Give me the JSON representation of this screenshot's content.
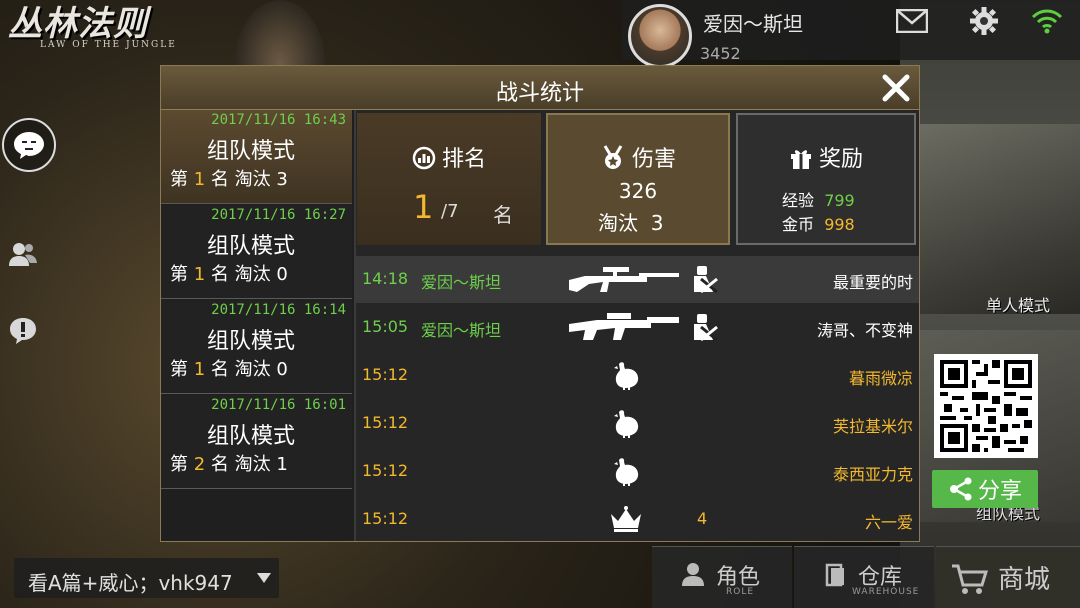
{
  "app": {
    "logo_title": "丛林法则",
    "logo_subtitle": "LAW OF THE JUNGLE"
  },
  "topbar": {
    "username": "爱因～斯坦",
    "currency": "3452",
    "icons": [
      "mail-icon",
      "gear-icon",
      "wifi-icon"
    ]
  },
  "dialog": {
    "title": "战斗统计",
    "close_label": "✕"
  },
  "records": [
    {
      "date": "2017/11/16 16:43",
      "mode": "组队模式",
      "rank_prefix": "第",
      "rank": "1",
      "rank_suffix": "名 淘汰",
      "kills": "3",
      "selected": true
    },
    {
      "date": "2017/11/16 16:27",
      "mode": "组队模式",
      "rank_prefix": "第",
      "rank": "1",
      "rank_suffix": "名 淘汰",
      "kills": "0",
      "selected": false
    },
    {
      "date": "2017/11/16 16:14",
      "mode": "组队模式",
      "rank_prefix": "第",
      "rank": "1",
      "rank_suffix": "名 淘汰",
      "kills": "0",
      "selected": false
    },
    {
      "date": "2017/11/16 16:01",
      "mode": "组队模式",
      "rank_prefix": "第",
      "rank": "2",
      "rank_suffix": "名 淘汰",
      "kills": "1",
      "selected": false
    }
  ],
  "summary": {
    "rank": {
      "title": "排名",
      "value": "1",
      "total": "/7",
      "unit": "名"
    },
    "damage": {
      "title": "伤害",
      "value": "326",
      "kills_label": "淘汰",
      "kills": "3"
    },
    "reward": {
      "title": "奖励",
      "exp_label": "经验",
      "exp": "799",
      "gold_label": "金币",
      "gold": "998"
    }
  },
  "kills": [
    {
      "time": "14:18",
      "killer": "爱因～斯坦",
      "weapon": "sniper-rifle-icon",
      "cause": "knockdown-icon",
      "extra": "",
      "victim": "最重要的时",
      "time_color": "#6ecf4a",
      "victim_color": "#ffffff",
      "highlight": true
    },
    {
      "time": "15:05",
      "killer": "爱因～斯坦",
      "weapon": "assault-rifle-icon",
      "cause": "knockdown-icon",
      "extra": "",
      "victim": "涛哥、不变神",
      "time_color": "#6ecf4a",
      "victim_color": "#ffffff",
      "highlight": false
    },
    {
      "time": "15:12",
      "killer": "",
      "weapon": "",
      "cause": "chicken-icon",
      "extra": "",
      "victim": "暮雨微凉",
      "time_color": "#f3b82d",
      "victim_color": "#f3b82d",
      "highlight": false
    },
    {
      "time": "15:12",
      "killer": "",
      "weapon": "",
      "cause": "chicken-icon",
      "extra": "",
      "victim": "芙拉基米尔",
      "time_color": "#f3b82d",
      "victim_color": "#f3b82d",
      "highlight": false
    },
    {
      "time": "15:12",
      "killer": "",
      "weapon": "",
      "cause": "chicken-icon",
      "extra": "",
      "victim": "泰西亚力克",
      "time_color": "#f3b82d",
      "victim_color": "#f3b82d",
      "highlight": false
    },
    {
      "time": "15:12",
      "killer": "",
      "weapon": "",
      "cause": "crown-icon",
      "extra": "4",
      "victim": "六一爱",
      "time_color": "#f3b82d",
      "victim_color": "#f3b82d",
      "highlight": false
    }
  ],
  "right_panel": {
    "single_mode": "单人模式",
    "team_mode": "组队模式",
    "share_label": "分享"
  },
  "chat": {
    "text": "看A篇+威心；vhk947"
  },
  "bottom_nav": {
    "role_label": "角色",
    "role_sub": "ROLE",
    "warehouse_label": "仓库",
    "warehouse_sub": "WAREHOUSE",
    "shop_label": "商城"
  },
  "colors": {
    "accent_green": "#6ecf4a",
    "accent_orange": "#f3b82d",
    "dialog_header": "#5a4a32"
  }
}
